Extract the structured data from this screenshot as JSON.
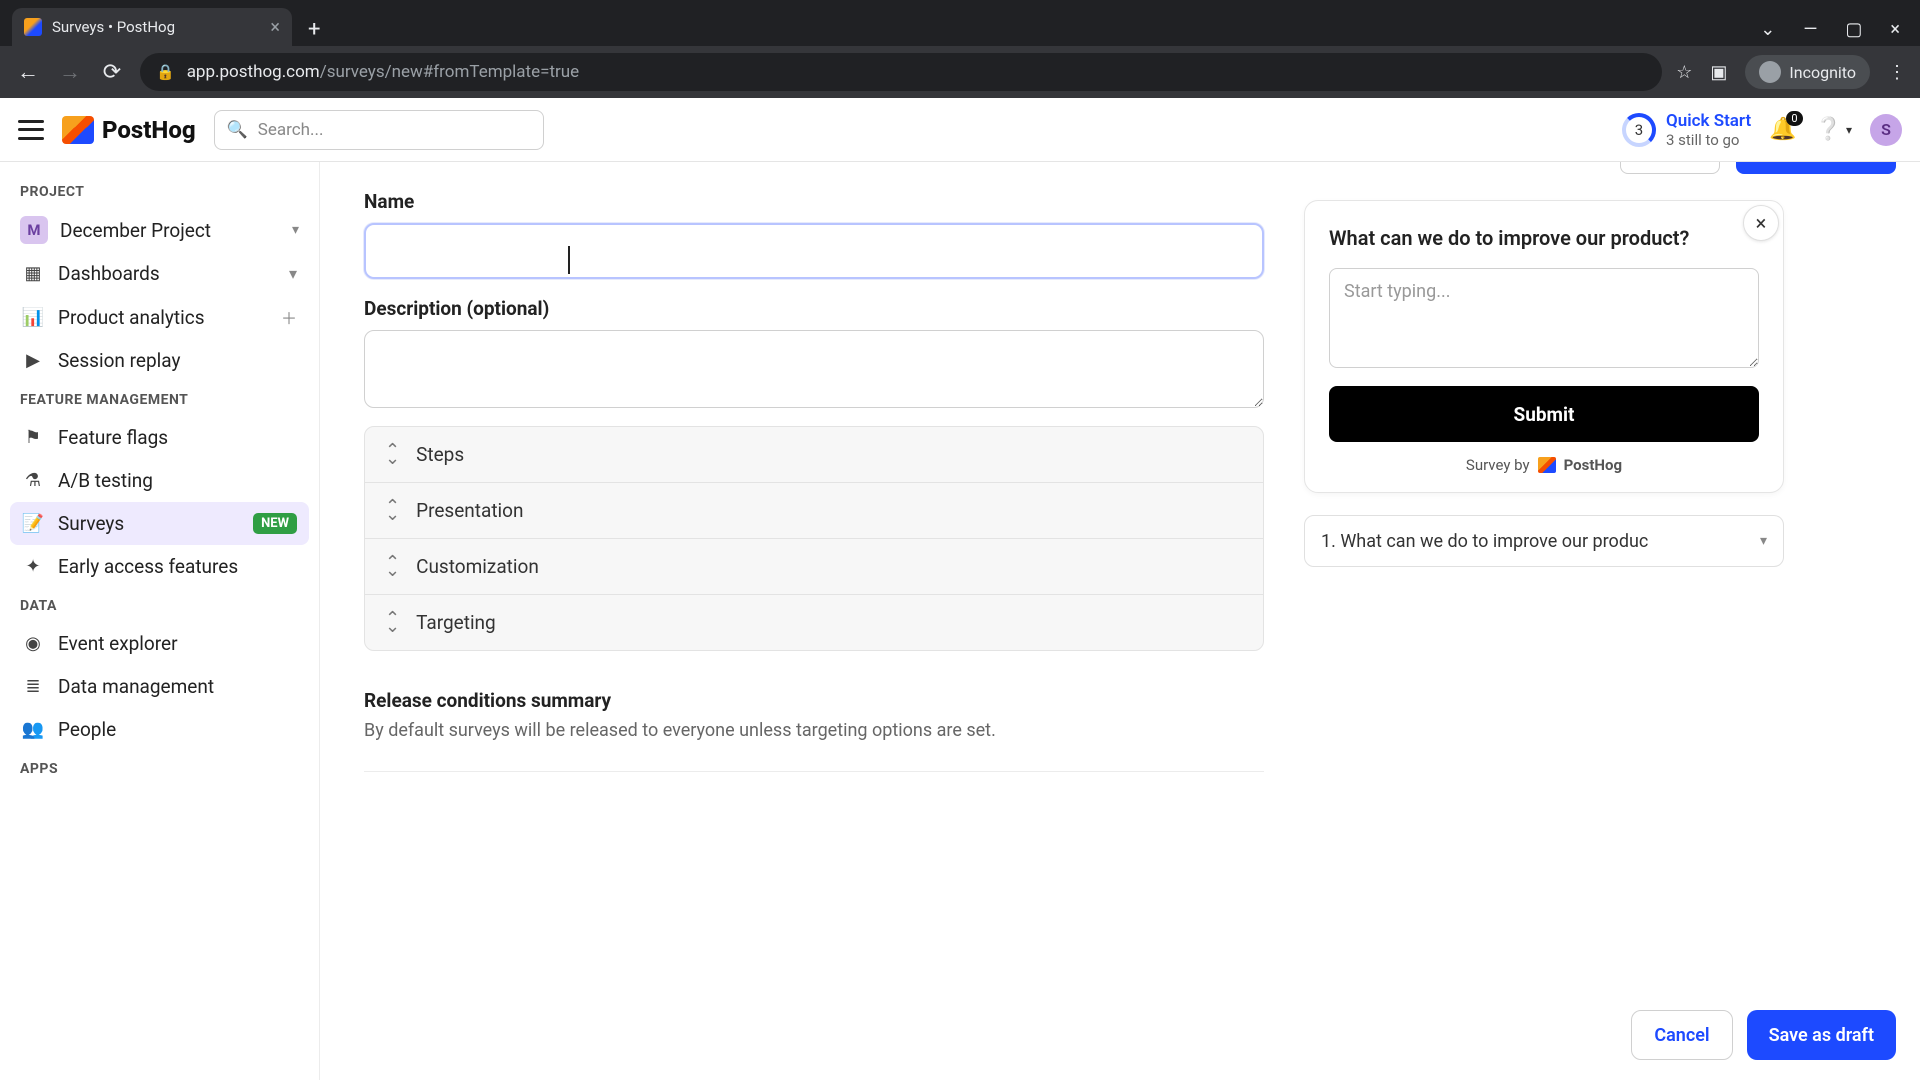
{
  "browser": {
    "tab_title": "Surveys • PostHog",
    "url_host": "app.posthog.com",
    "url_path": "/surveys/new#fromTemplate=true",
    "incognito_label": "Incognito"
  },
  "topnav": {
    "logo_text": "PostHog",
    "search_placeholder": "Search...",
    "quick_start_title": "Quick Start",
    "quick_start_sub": "3 still to go",
    "quick_start_count": "3",
    "notif_count": "0",
    "avatar_letter": "S"
  },
  "sidebar": {
    "sections": {
      "project": "PROJECT",
      "feature": "FEATURE MANAGEMENT",
      "data": "DATA",
      "apps": "APPS"
    },
    "project_badge": "M",
    "project_name": "December Project",
    "items_top": [
      {
        "label": "Dashboards",
        "icon": "▦",
        "trail": "caret"
      },
      {
        "label": "Product analytics",
        "icon": "⫾",
        "trail": "plus"
      },
      {
        "label": "Session replay",
        "icon": "▶"
      }
    ],
    "items_feature": [
      {
        "label": "Feature flags",
        "icon": "⚑"
      },
      {
        "label": "A/B testing",
        "icon": "⚗"
      },
      {
        "label": "Surveys",
        "icon": "✉",
        "badge": "NEW",
        "active": true
      },
      {
        "label": "Early access features",
        "icon": "✦"
      }
    ],
    "items_data": [
      {
        "label": "Event explorer",
        "icon": "(•)"
      },
      {
        "label": "Data management",
        "icon": "≡"
      },
      {
        "label": "People",
        "icon": "👥"
      }
    ]
  },
  "form": {
    "name_label": "Name",
    "name_value": "",
    "desc_label": "Description (optional)",
    "desc_value": "",
    "accordion": [
      "Steps",
      "Presentation",
      "Customization",
      "Targeting"
    ],
    "release_title": "Release conditions summary",
    "release_text": "By default surveys will be released to everyone unless targeting options are set.",
    "cancel": "Cancel",
    "save": "Save as draft"
  },
  "preview": {
    "question": "What can we do to improve our product?",
    "placeholder": "Start typing...",
    "submit": "Submit",
    "brand_prefix": "Survey by",
    "brand_name": "PostHog",
    "select_label": "1. What can we do to improve our produc"
  }
}
